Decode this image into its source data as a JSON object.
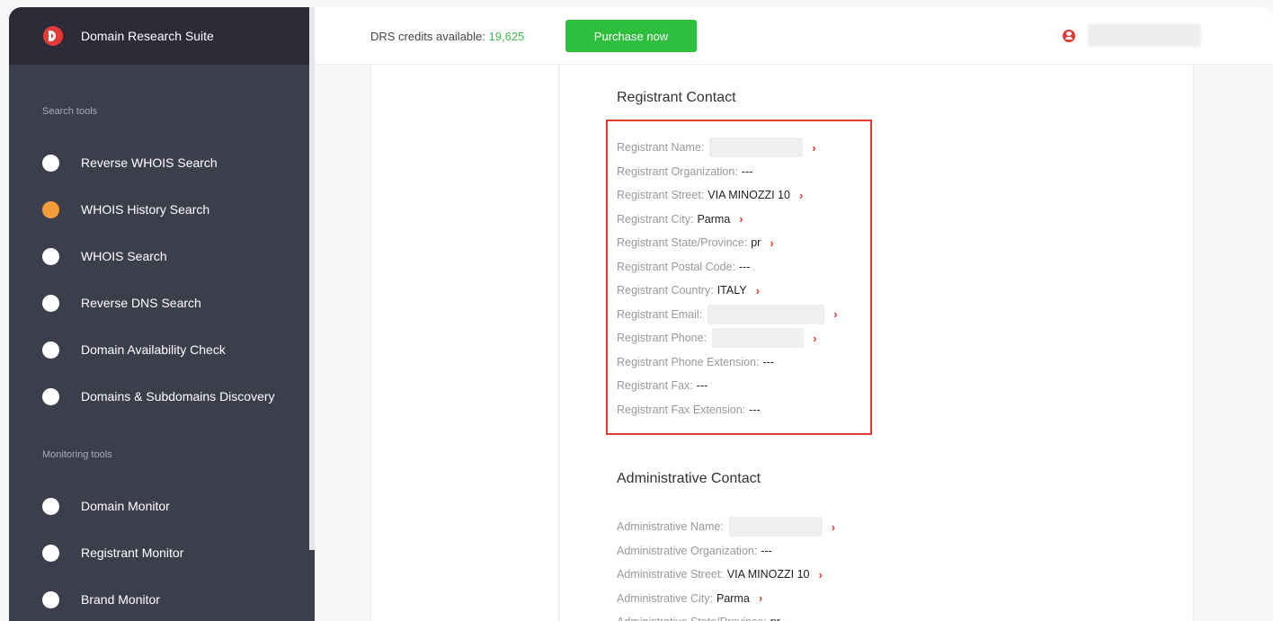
{
  "app": {
    "name": "Domain Research Suite"
  },
  "sidebar": {
    "search_label": "Search tools",
    "search_items": [
      {
        "label": "Reverse WHOIS Search",
        "icon": "compass-icon"
      },
      {
        "label": "WHOIS History Search",
        "icon": "history-icon",
        "active": true
      },
      {
        "label": "WHOIS Search",
        "icon": "user-circle-icon"
      },
      {
        "label": "Reverse DNS Search",
        "icon": "globe-icon"
      },
      {
        "label": "Domain Availability Check",
        "icon": "alert-icon"
      },
      {
        "label": "Domains & Subdomains Discovery",
        "icon": "target-icon"
      }
    ],
    "monitoring_label": "Monitoring tools",
    "monitoring_items": [
      {
        "label": "Domain Monitor",
        "icon": "www-icon"
      },
      {
        "label": "Registrant Monitor",
        "icon": "registrant-icon"
      },
      {
        "label": "Brand Monitor",
        "icon": "registered-icon"
      }
    ]
  },
  "topbar": {
    "credits_label": "DRS credits available:",
    "credits_value": "19,625",
    "purchase_label": "Purchase now"
  },
  "registrant": {
    "title": "Registrant Contact",
    "fields": [
      {
        "label": "Registrant Name:",
        "value": "",
        "redacted": true,
        "link": true
      },
      {
        "label": "Registrant Organization:",
        "value": "---",
        "link": false
      },
      {
        "label": "Registrant Street:",
        "value": "VIA MINOZZI 10",
        "link": true
      },
      {
        "label": "Registrant City:",
        "value": "Parma",
        "link": true
      },
      {
        "label": "Registrant State/Province:",
        "value": "pr",
        "link": true
      },
      {
        "label": "Registrant Postal Code:",
        "value": "---",
        "link": false
      },
      {
        "label": "Registrant Country:",
        "value": "ITALY",
        "link": true
      },
      {
        "label": "Registrant Email:",
        "value": "",
        "redacted": true,
        "link": true
      },
      {
        "label": "Registrant Phone:",
        "value": "",
        "redacted": true,
        "link": true
      },
      {
        "label": "Registrant Phone Extension:",
        "value": "---",
        "link": false
      },
      {
        "label": "Registrant Fax:",
        "value": "---",
        "link": false
      },
      {
        "label": "Registrant Fax Extension:",
        "value": "---",
        "link": false
      }
    ]
  },
  "administrative": {
    "title": "Administrative Contact",
    "fields": [
      {
        "label": "Administrative Name:",
        "value": "",
        "redacted": true,
        "link": true
      },
      {
        "label": "Administrative Organization:",
        "value": "---",
        "link": false
      },
      {
        "label": "Administrative Street:",
        "value": "VIA MINOZZI 10",
        "link": true
      },
      {
        "label": "Administrative City:",
        "value": "Parma",
        "link": true
      },
      {
        "label": "Administrative State/Province:",
        "value": "pr",
        "link": true
      }
    ]
  },
  "colors": {
    "accent": "#e53935",
    "sidebar_bg": "#3d3e4c",
    "button_green": "#2dbf3d",
    "credits_green": "#3cbd4e"
  }
}
